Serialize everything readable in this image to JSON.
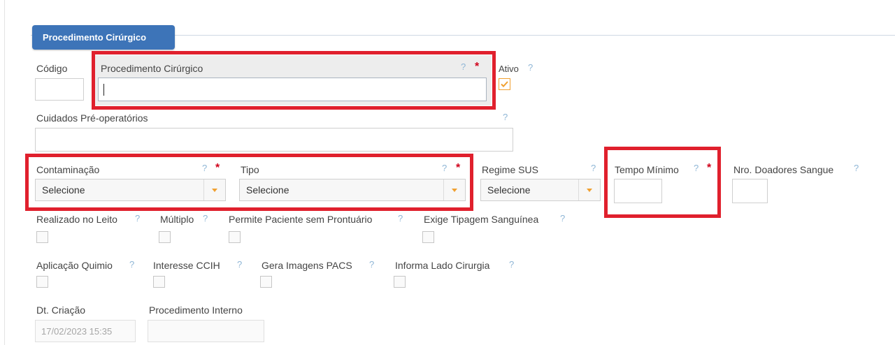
{
  "panel": {
    "title": "Procedimento Cirúrgico"
  },
  "fields": {
    "codigo": {
      "label": "Código",
      "value": ""
    },
    "procedimento": {
      "label": "Procedimento Cirúrgico",
      "value": ""
    },
    "ativo": {
      "label": "Ativo",
      "checked": true
    },
    "cuidados": {
      "label": "Cuidados Pré-operatórios",
      "value": ""
    },
    "contaminacao": {
      "label": "Contaminação",
      "value": "Selecione"
    },
    "tipo": {
      "label": "Tipo",
      "value": "Selecione"
    },
    "regime": {
      "label": "Regime SUS",
      "value": "Selecione"
    },
    "tempo": {
      "label": "Tempo Mínimo",
      "value": ""
    },
    "doadores": {
      "label": "Nro. Doadores Sangue",
      "value": ""
    },
    "realizado": {
      "label": "Realizado no Leito"
    },
    "multiplo": {
      "label": "Múltiplo"
    },
    "permite": {
      "label": "Permite Paciente sem Prontuário"
    },
    "exige": {
      "label": "Exige Tipagem Sanguínea"
    },
    "aplicacao": {
      "label": "Aplicação Quimio"
    },
    "interesse": {
      "label": "Interesse CCIH"
    },
    "gera": {
      "label": "Gera Imagens PACS"
    },
    "informa": {
      "label": "Informa Lado Cirurgia"
    },
    "dtcriacao": {
      "label": "Dt. Criação",
      "value": "17/02/2023 15:35"
    },
    "interno": {
      "label": "Procedimento Interno",
      "value": ""
    }
  },
  "symbols": {
    "help": "?",
    "required": "*"
  },
  "colors": {
    "tab_bg": "#3d74b8",
    "highlight": "#e0202d",
    "check": "#f0a030"
  }
}
